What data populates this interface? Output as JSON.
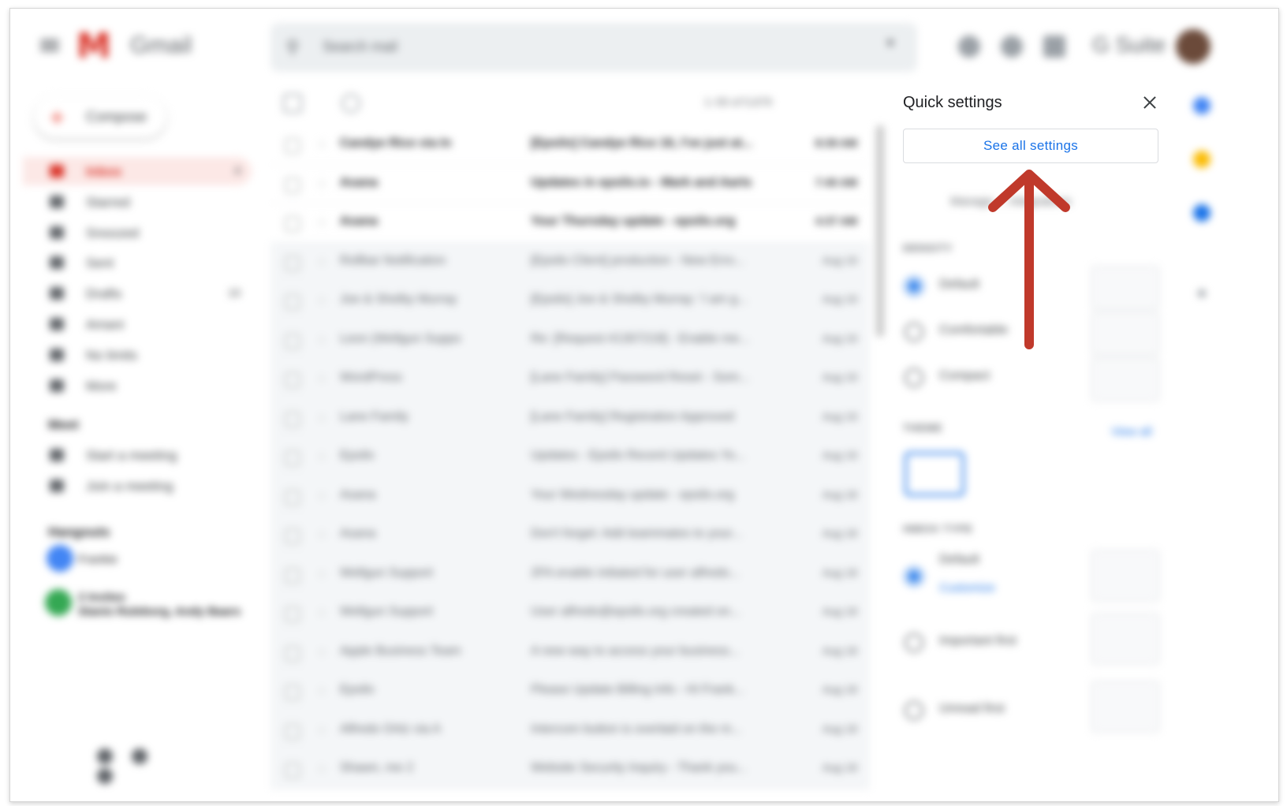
{
  "header": {
    "app_name": "Gmail",
    "search_placeholder": "Search mail",
    "suite_label": "G Suite"
  },
  "sidebar": {
    "compose_label": "Compose",
    "items": [
      {
        "label": "Inbox",
        "count": "4",
        "active": true
      },
      {
        "label": "Starred",
        "count": ""
      },
      {
        "label": "Snoozed",
        "count": ""
      },
      {
        "label": "Sent",
        "count": ""
      },
      {
        "label": "Drafts",
        "count": "10"
      },
      {
        "label": "Amani",
        "count": ""
      },
      {
        "label": "No limits",
        "count": ""
      },
      {
        "label": "More",
        "count": ""
      }
    ],
    "meet_title": "Meet",
    "meet_items": [
      "Start a meeting",
      "Join a meeting"
    ],
    "hangouts_title": "Hangouts",
    "hangouts_user": "Frankie",
    "hangouts_group_title": "2 Invites",
    "hangouts_group_members": "Stanis Ruleborg, Andy Baars"
  },
  "toolbar": {
    "pagination": "1–50 of 5,679"
  },
  "emails": [
    {
      "from": "Candye Rice via In",
      "subject": "[Epsilo] Candye Rice 16, I've just at...",
      "date": "8:39 AM",
      "unread": true
    },
    {
      "from": "Asana",
      "subject": "Updates in epsilo.io - Mark and Aarts",
      "date": "7:40 AM",
      "unread": true
    },
    {
      "from": "Asana",
      "subject": "Your Thursday update - epsilo.org",
      "date": "4:37 AM",
      "unread": true
    },
    {
      "from": "Rollbar Notification",
      "subject": "[Epsilo Client] production - New Erro...",
      "date": "Aug 19",
      "unread": false
    },
    {
      "from": "Joe & Shelby Murray",
      "subject": "[Epsilo] Joe & Shelby Murray: 'I am g...",
      "date": "Aug 19",
      "unread": false
    },
    {
      "from": "Leon (Wellgun Suppo",
      "subject": "Re: [Request #1307218] - Enable me...",
      "date": "Aug 19",
      "unread": false
    },
    {
      "from": "WordPress",
      "subject": "[Lane Family] Password Reset - Som...",
      "date": "Aug 19",
      "unread": false
    },
    {
      "from": "Lane Family",
      "subject": "[Lane Family] Registration Approved",
      "date": "Aug 19",
      "unread": false
    },
    {
      "from": "Epsilo",
      "subject": "Updates - Epsilo Recent Updates Yo...",
      "date": "Aug 19",
      "unread": false
    },
    {
      "from": "Asana",
      "subject": "Your Wednesday update - epsilo.org",
      "date": "Aug 18",
      "unread": false
    },
    {
      "from": "Asana",
      "subject": "Don't forget: Add teammates to your...",
      "date": "Aug 18",
      "unread": false
    },
    {
      "from": "Wellgun Support",
      "subject": "2FA enable initiated for user alfredo...",
      "date": "Aug 18",
      "unread": false
    },
    {
      "from": "Wellgun Support",
      "subject": "User alfredo@epsilo.org created on...",
      "date": "Aug 18",
      "unread": false
    },
    {
      "from": "Apple Business Team",
      "subject": "A new way to access your business...",
      "date": "Aug 18",
      "unread": false
    },
    {
      "from": "Epsilo",
      "subject": "Please Update Billing Info - Hi Frank...",
      "date": "Aug 18",
      "unread": false
    },
    {
      "from": "Alfredo Ortiz via A",
      "subject": "Intercom button is overlaid on the m...",
      "date": "Aug 18",
      "unread": false
    },
    {
      "from": "Shawn, me 2",
      "subject": "Website Security Inquiry - Thank you...",
      "date": "Aug 18",
      "unread": false
    }
  ],
  "quick_settings": {
    "title": "Quick settings",
    "see_all_label": "See all settings",
    "tabs_label": "Manage ... Integrations",
    "density_title": "DENSITY",
    "density_options": [
      "Default",
      "Comfortable",
      "Compact"
    ],
    "theme_title": "THEME",
    "view_all_label": "View all",
    "inbox_type_title": "INBOX TYPE",
    "inbox_options": [
      "Default",
      "Important first",
      "Unread first"
    ],
    "customize_label": "Customize"
  },
  "colors": {
    "accent": "#1a73e8",
    "gmail_red": "#d93025",
    "annotation_arrow": "#c0392b"
  },
  "icons": {
    "header": [
      "menu-icon",
      "gmail-logo",
      "search-icon",
      "help-icon",
      "gear-icon",
      "apps-icon"
    ],
    "annotation": "arrow-up-icon"
  }
}
